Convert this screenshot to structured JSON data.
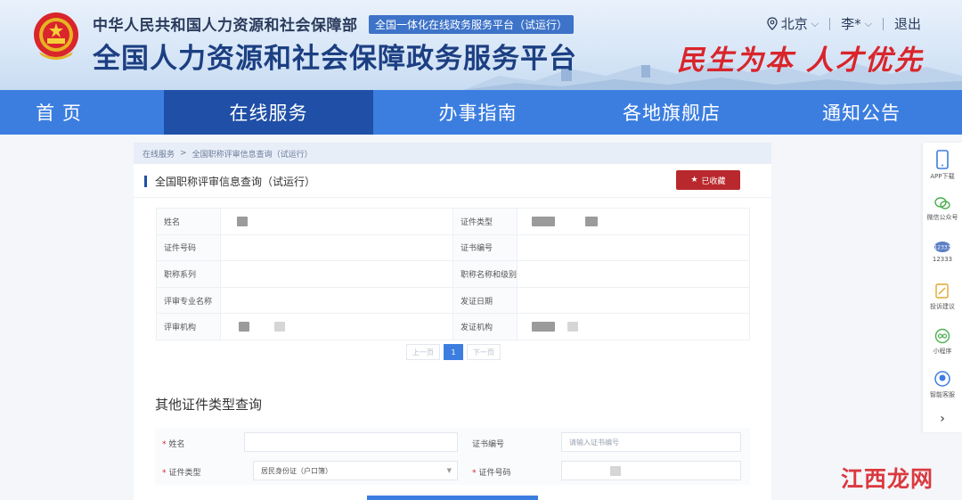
{
  "header": {
    "sub_title": "中华人民共和国人力资源和社会保障部",
    "badge": "全国一体化在线政务服务平台（试运行）",
    "main_title": "全国人力资源和社会保障政务服务平台",
    "slogan": "民生为本 人才优先",
    "location": "北京",
    "user": "李*",
    "logout": "退出"
  },
  "nav": {
    "items": [
      {
        "label": "首 页"
      },
      {
        "label": "在线服务"
      },
      {
        "label": "办事指南"
      },
      {
        "label": "各地旗舰店"
      },
      {
        "label": "通知公告"
      }
    ],
    "active_index": 1
  },
  "breadcrumb": {
    "items": [
      "在线服务",
      ">",
      "全国职称评审信息查询（试运行）"
    ]
  },
  "section": {
    "title": "全国职称评审信息查询（试运行）",
    "favorite_label": "已收藏"
  },
  "info_table": {
    "rows": [
      {
        "l1": "姓名",
        "l2": "证件类型"
      },
      {
        "l1": "证件号码",
        "l2": "证书编号"
      },
      {
        "l1": "职称系列",
        "l2": "职称名称和级别"
      },
      {
        "l1": "评审专业名称",
        "l2": "发证日期"
      },
      {
        "l1": "评审机构",
        "l2": "发证机构"
      }
    ]
  },
  "pager": {
    "prev": "上一页",
    "current": "1",
    "next": "下一页"
  },
  "other_query": {
    "title": "其他证件类型查询",
    "name_label": "姓名",
    "cert_no_label": "证书编号",
    "cert_no_placeholder": "请输入证书编号",
    "id_type_label": "证件类型",
    "id_type_value": "居民身份证（户口簿）",
    "id_no_label": "证件号码"
  },
  "sidebar": {
    "items": [
      {
        "label": "APP下载",
        "icon": "phone-icon"
      },
      {
        "label": "微信公众号",
        "icon": "wechat-icon"
      },
      {
        "label": "12333",
        "icon": "hotline-icon"
      },
      {
        "label": "投诉建议",
        "icon": "edit-icon"
      },
      {
        "label": "小程序",
        "icon": "mini-program-icon"
      },
      {
        "label": "智能客服",
        "icon": "support-icon"
      }
    ]
  },
  "watermark": "江西龙网",
  "colors": {
    "nav_bg": "#3c7ee0",
    "nav_active": "#1f4fa6",
    "title_blue": "#1c3f82",
    "red": "#d9252b",
    "fav_button": "#b9282d"
  }
}
